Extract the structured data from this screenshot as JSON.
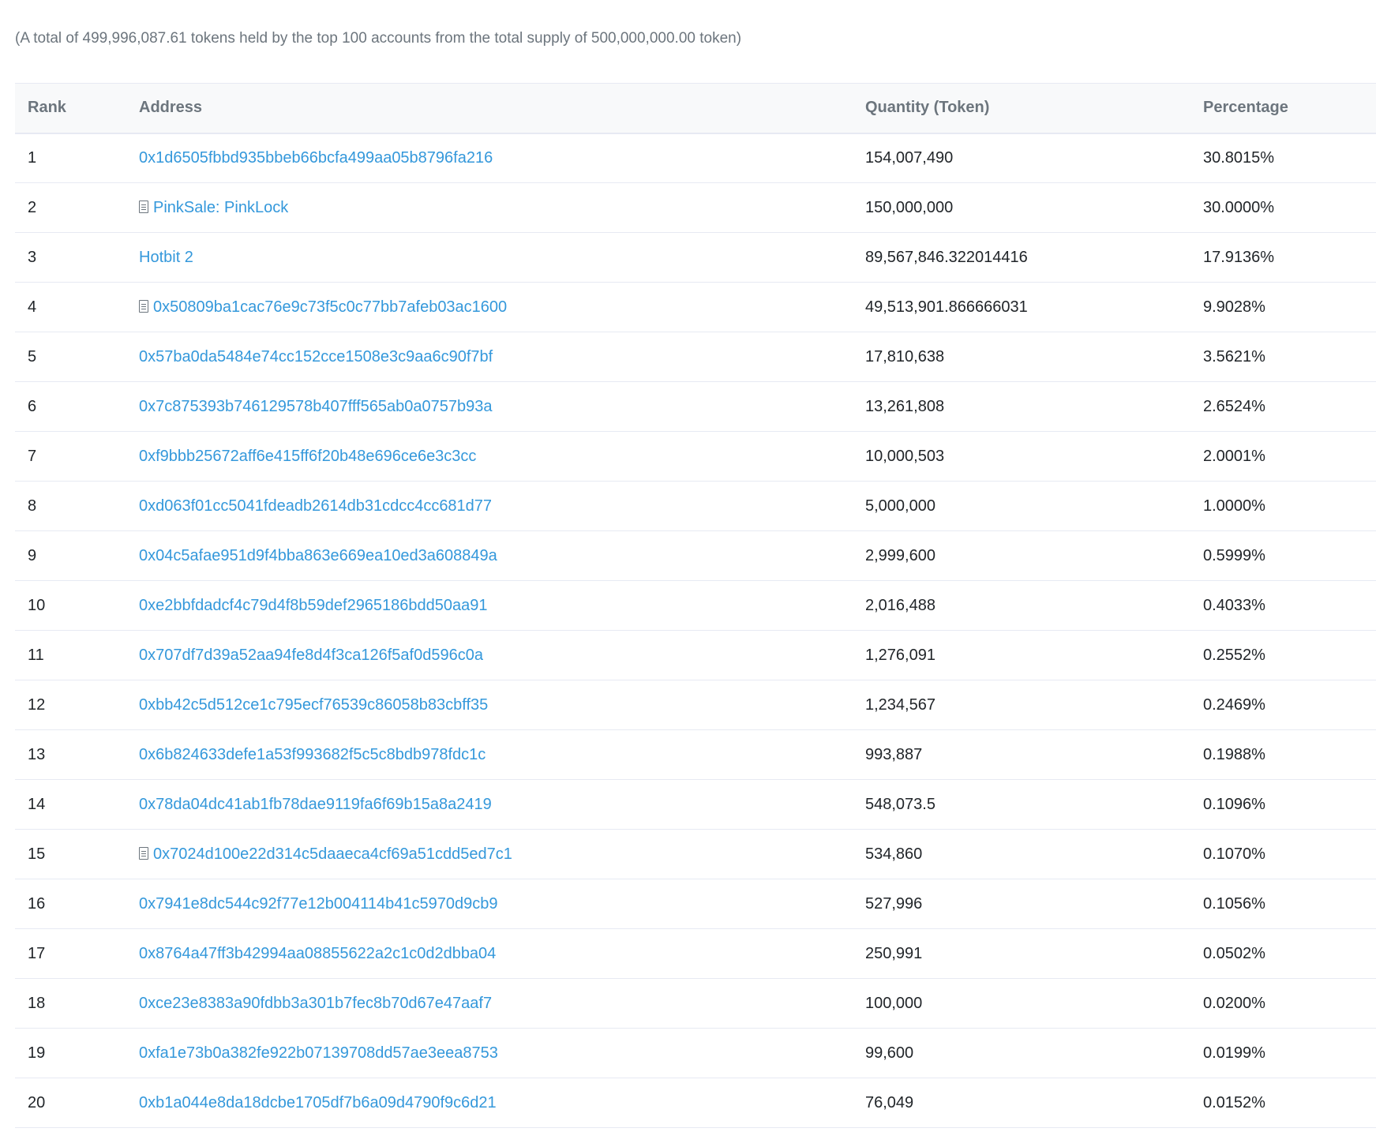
{
  "summary": "(A total of 499,996,087.61 tokens held by the top 100 accounts from the total supply of 500,000,000.00 token)",
  "table": {
    "headers": {
      "rank": "Rank",
      "address": "Address",
      "quantity": "Quantity (Token)",
      "percentage": "Percentage"
    },
    "rows": [
      {
        "rank": "1",
        "address": "0x1d6505fbbd935bbeb66bcfa499aa05b8796fa216",
        "contract": false,
        "quantity": "154,007,490",
        "percentage": "30.8015%"
      },
      {
        "rank": "2",
        "address": "PinkSale: PinkLock",
        "contract": true,
        "quantity": "150,000,000",
        "percentage": "30.0000%"
      },
      {
        "rank": "3",
        "address": "Hotbit 2",
        "contract": false,
        "quantity": "89,567,846.322014416",
        "percentage": "17.9136%"
      },
      {
        "rank": "4",
        "address": "0x50809ba1cac76e9c73f5c0c77bb7afeb03ac1600",
        "contract": true,
        "quantity": "49,513,901.866666031",
        "percentage": "9.9028%"
      },
      {
        "rank": "5",
        "address": "0x57ba0da5484e74cc152cce1508e3c9aa6c90f7bf",
        "contract": false,
        "quantity": "17,810,638",
        "percentage": "3.5621%"
      },
      {
        "rank": "6",
        "address": "0x7c875393b746129578b407fff565ab0a0757b93a",
        "contract": false,
        "quantity": "13,261,808",
        "percentage": "2.6524%"
      },
      {
        "rank": "7",
        "address": "0xf9bbb25672aff6e415ff6f20b48e696ce6e3c3cc",
        "contract": false,
        "quantity": "10,000,503",
        "percentage": "2.0001%"
      },
      {
        "rank": "8",
        "address": "0xd063f01cc5041fdeadb2614db31cdcc4cc681d77",
        "contract": false,
        "quantity": "5,000,000",
        "percentage": "1.0000%"
      },
      {
        "rank": "9",
        "address": "0x04c5afae951d9f4bba863e669ea10ed3a608849a",
        "contract": false,
        "quantity": "2,999,600",
        "percentage": "0.5999%"
      },
      {
        "rank": "10",
        "address": "0xe2bbfdadcf4c79d4f8b59def2965186bdd50aa91",
        "contract": false,
        "quantity": "2,016,488",
        "percentage": "0.4033%"
      },
      {
        "rank": "11",
        "address": "0x707df7d39a52aa94fe8d4f3ca126f5af0d596c0a",
        "contract": false,
        "quantity": "1,276,091",
        "percentage": "0.2552%"
      },
      {
        "rank": "12",
        "address": "0xbb42c5d512ce1c795ecf76539c86058b83cbff35",
        "contract": false,
        "quantity": "1,234,567",
        "percentage": "0.2469%"
      },
      {
        "rank": "13",
        "address": "0x6b824633defe1a53f993682f5c5c8bdb978fdc1c",
        "contract": false,
        "quantity": "993,887",
        "percentage": "0.1988%"
      },
      {
        "rank": "14",
        "address": "0x78da04dc41ab1fb78dae9119fa6f69b15a8a2419",
        "contract": false,
        "quantity": "548,073.5",
        "percentage": "0.1096%"
      },
      {
        "rank": "15",
        "address": "0x7024d100e22d314c5daaeca4cf69a51cdd5ed7c1",
        "contract": true,
        "quantity": "534,860",
        "percentage": "0.1070%"
      },
      {
        "rank": "16",
        "address": "0x7941e8dc544c92f77e12b004114b41c5970d9cb9",
        "contract": false,
        "quantity": "527,996",
        "percentage": "0.1056%"
      },
      {
        "rank": "17",
        "address": "0x8764a47ff3b42994aa08855622a2c1c0d2dbba04",
        "contract": false,
        "quantity": "250,991",
        "percentage": "0.0502%"
      },
      {
        "rank": "18",
        "address": "0xce23e8383a90fdbb3a301b7fec8b70d67e47aaf7",
        "contract": false,
        "quantity": "100,000",
        "percentage": "0.0200%"
      },
      {
        "rank": "19",
        "address": "0xfa1e73b0a382fe922b07139708dd57ae3eea8753",
        "contract": false,
        "quantity": "99,600",
        "percentage": "0.0199%"
      },
      {
        "rank": "20",
        "address": "0xb1a044e8da18dcbe1705df7b6a09d4790f9c6d21",
        "contract": false,
        "quantity": "76,049",
        "percentage": "0.0152%"
      }
    ]
  },
  "icons": {
    "contract": "contract-document-icon"
  },
  "colors": {
    "link": "#3498db",
    "muted": "#6c757d",
    "border": "#e7eaf3"
  }
}
